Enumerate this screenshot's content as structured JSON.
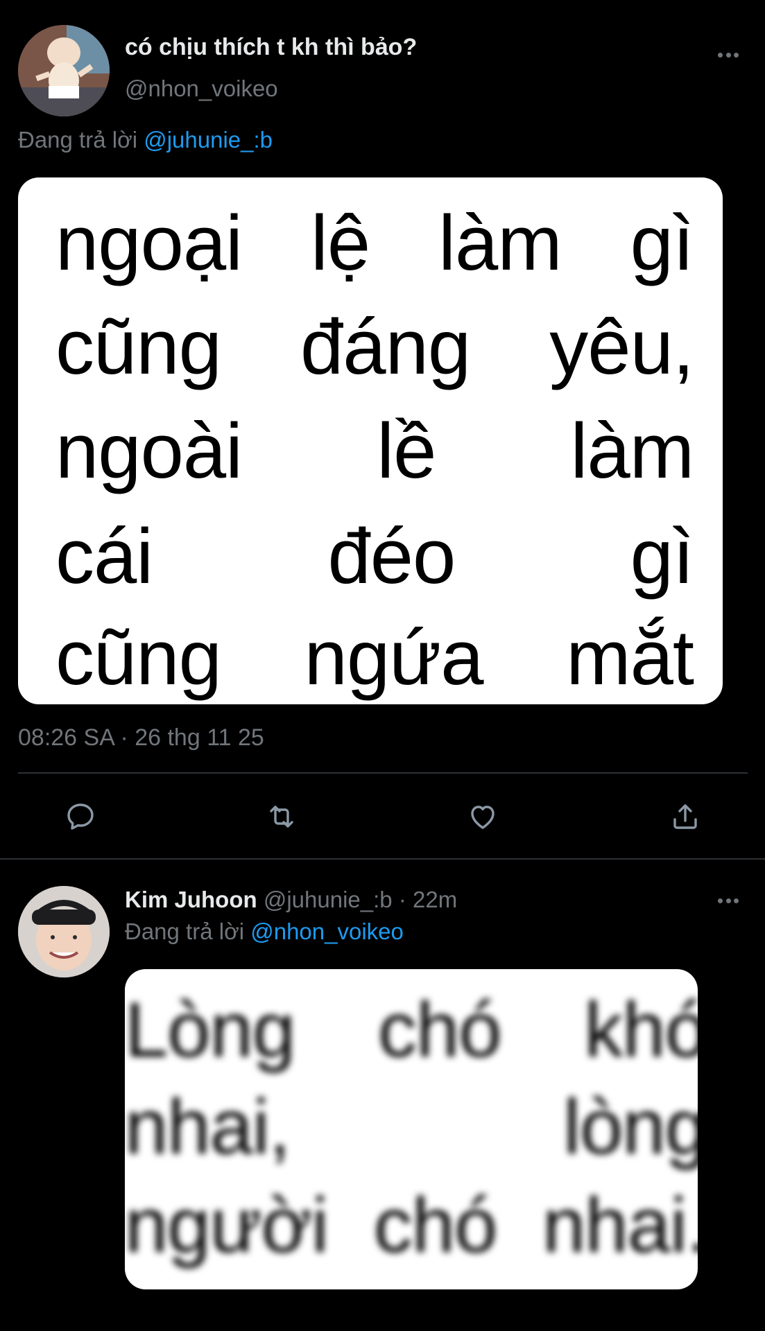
{
  "tweet1": {
    "display_name": "có chịu thích t kh thì bảo?",
    "handle": "@nhon_voikeo",
    "reply_prefix": "Đang trả lời",
    "reply_to": "@juhunie_:b",
    "image_lines": [
      "ngoại lệ làm gì",
      "cũng đáng yêu,",
      "ngoài lề làm",
      "cái đéo gì",
      "cũng ngứa mắt"
    ],
    "timestamp": "08:26 SA · 26 thg 11 25",
    "actions": [
      "reply-icon",
      "retweet-icon",
      "like-icon",
      "share-icon"
    ]
  },
  "tweet2": {
    "display_name": "Kim Juhoon",
    "handle": "@juhunie_:b",
    "separator": "·",
    "time": "22m",
    "reply_prefix": "Đang trả lời",
    "reply_to": "@nhon_voikeo",
    "image_lines": [
      "Lòng chó khó",
      "nhai, lòng",
      "người chó nhai."
    ]
  },
  "colors": {
    "background": "#000000",
    "link": "#1d9bf0",
    "muted": "#71767b",
    "divider": "#2f3336"
  }
}
